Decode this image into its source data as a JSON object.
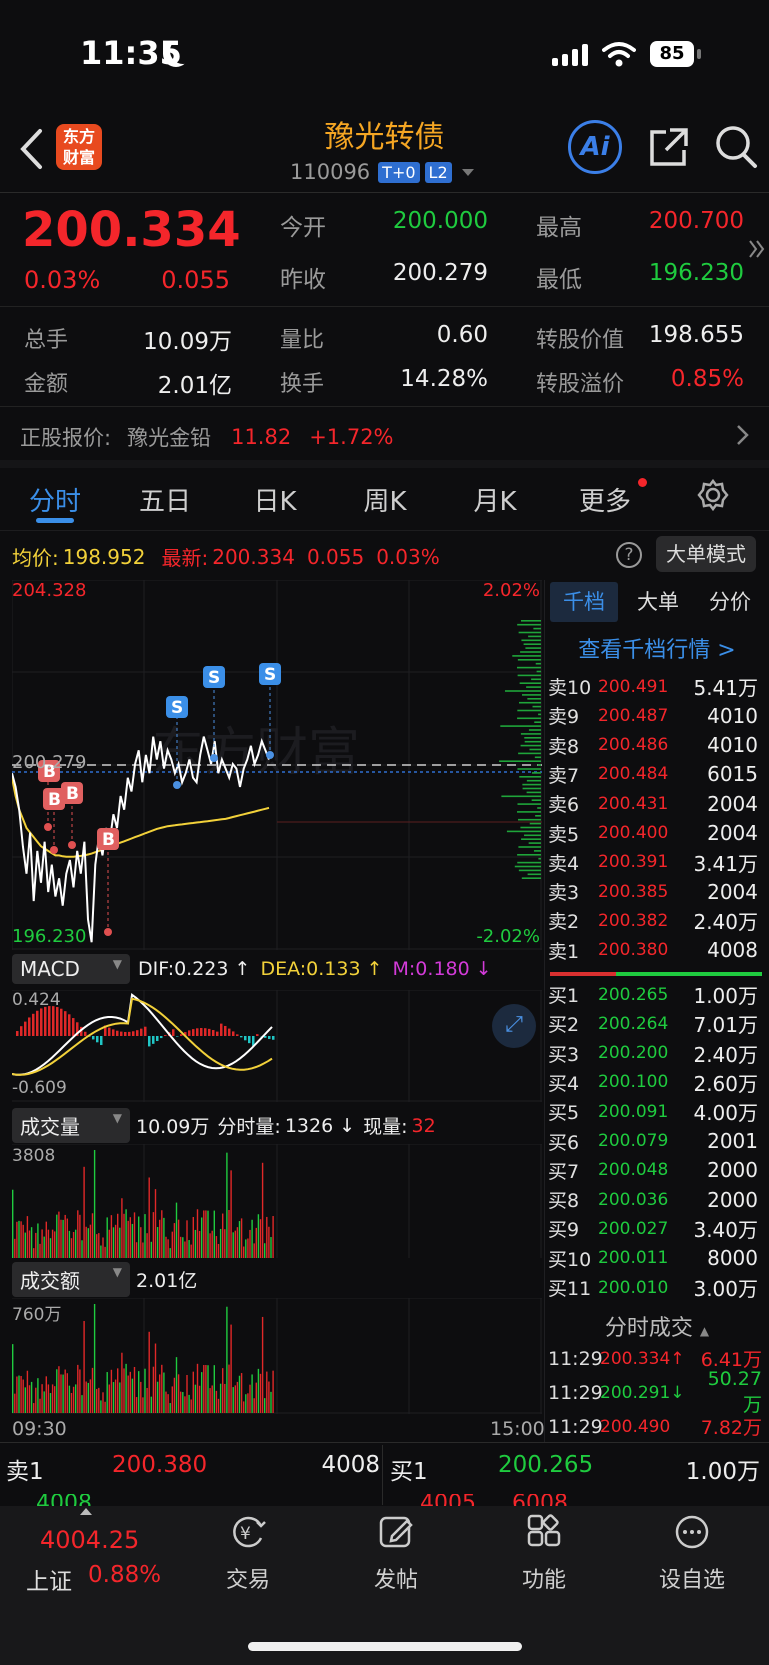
{
  "status": {
    "time": "11:35",
    "battery": "85"
  },
  "header": {
    "logo_line1": "东方",
    "logo_line2": "财富",
    "title": "豫光转债",
    "code": "110096",
    "badge1": "T+0",
    "badge2": "L2",
    "ai": "Ai"
  },
  "quote": {
    "price": "200.334",
    "pct": "0.03%",
    "chg": "0.055",
    "open_label": "今开",
    "open": "200.000",
    "high_label": "最高",
    "high": "200.700",
    "prev_label": "昨收",
    "prev": "200.279",
    "low_label": "最低",
    "low": "196.230",
    "vol_label": "总手",
    "vol": "10.09万",
    "ratio_label": "量比",
    "ratio": "0.60",
    "conv_label": "转股价值",
    "conv": "198.655",
    "amt_label": "金额",
    "amt": "2.01亿",
    "turn_label": "换手",
    "turn": "14.28%",
    "prem_label": "转股溢价",
    "prem": "0.85%"
  },
  "stock": {
    "label": "正股报价:",
    "name": "豫光金铅",
    "price": "11.82",
    "pct": "+1.72%"
  },
  "tabs": [
    "分时",
    "五日",
    "日K",
    "周K",
    "月K",
    "更多"
  ],
  "chart_head": {
    "avg_label": "均价:",
    "avg": "198.952",
    "latest_label": "最新:",
    "latest": "200.334",
    "chg": "0.055",
    "pct": "0.03%",
    "mode": "大单模式"
  },
  "chart_data": {
    "type": "line",
    "ylim": [
      196.23,
      204.328
    ],
    "y_top_label": "204.328",
    "y_bottom_label": "196.230",
    "y_prev_label": "200.279",
    "pct_top": "2.02%",
    "pct_bottom": "-2.02%",
    "x_start": "09:30",
    "x_end": "15:00",
    "price": [
      200.1,
      199.8,
      199.3,
      198.5,
      197.9,
      198.8,
      197.3,
      198.4,
      197.7,
      198.6,
      197.5,
      198.1,
      197.4,
      197.8,
      197.2,
      197.9,
      198.2,
      197.6,
      198.4,
      197.9,
      198.6,
      196.9,
      196.4,
      198.1,
      198.7,
      198.3,
      198.9,
      198.6,
      199.2,
      198.9,
      199.6,
      199.3,
      200.0,
      199.7,
      200.3,
      200.6,
      199.9,
      200.5,
      200.1,
      200.9,
      200.4,
      200.8,
      200.2,
      200.6,
      200.4,
      200.1,
      200.3,
      199.9,
      200.1,
      200.4,
      200.0,
      199.9,
      200.5,
      200.9,
      200.6,
      200.3,
      200.8,
      200.1,
      200.4,
      200.2,
      200.0,
      200.3,
      200.2,
      199.8,
      200.2,
      200.4,
      200.7,
      200.3,
      200.5,
      200.8,
      200.6,
      200.4
    ],
    "avg": [
      200.0,
      199.6,
      199.3,
      199.1,
      198.9,
      198.8,
      198.7,
      198.6,
      198.5,
      198.45,
      198.4,
      198.35,
      198.3,
      198.3,
      198.28,
      198.27,
      198.27,
      198.27,
      198.28,
      198.29,
      198.3,
      198.32,
      198.34,
      198.37,
      198.4,
      198.43,
      198.46,
      198.49,
      198.52,
      198.55,
      198.58,
      198.61,
      198.64,
      198.67,
      198.7,
      198.73,
      198.76,
      198.79,
      198.82,
      198.85,
      198.88,
      198.9,
      198.92,
      198.94,
      198.95,
      198.96,
      198.97,
      198.98,
      198.99,
      199.0,
      199.01,
      199.02,
      199.03,
      199.04,
      199.05,
      199.06,
      199.07,
      199.08,
      199.09,
      199.1,
      199.12,
      199.14,
      199.16,
      199.18,
      199.2,
      199.22,
      199.24,
      199.26,
      199.28,
      199.3,
      199.32,
      199.34
    ]
  },
  "macd": {
    "label": "MACD",
    "dif": "DIF:0.223 ↑",
    "dea": "DEA:0.133 ↑",
    "m": "M:0.180 ↓",
    "top": "0.424",
    "bottom": "-0.609"
  },
  "volume": {
    "label": "成交量",
    "summary": "10.09万",
    "minute_label": "分时量:",
    "minute": "1326 ↓",
    "now_label": "现量:",
    "now": "32",
    "top": "3808"
  },
  "amount": {
    "label": "成交额",
    "summary": "2.01亿",
    "top": "760万"
  },
  "orderbook": {
    "tab1": "千档",
    "tab2": "大单",
    "tab3": "分价",
    "link": "查看千档行情 >",
    "sells": [
      [
        "卖10",
        "200.491",
        "5.41万"
      ],
      [
        "卖9",
        "200.487",
        "4010"
      ],
      [
        "卖8",
        "200.486",
        "4010"
      ],
      [
        "卖7",
        "200.484",
        "6015"
      ],
      [
        "卖6",
        "200.431",
        "2004"
      ],
      [
        "卖5",
        "200.400",
        "2004"
      ],
      [
        "卖4",
        "200.391",
        "3.41万"
      ],
      [
        "卖3",
        "200.385",
        "2004"
      ],
      [
        "卖2",
        "200.382",
        "2.40万"
      ],
      [
        "卖1",
        "200.380",
        "4008"
      ]
    ],
    "buys": [
      [
        "买1",
        "200.265",
        "1.00万"
      ],
      [
        "买2",
        "200.264",
        "7.01万"
      ],
      [
        "买3",
        "200.200",
        "2.40万"
      ],
      [
        "买4",
        "200.100",
        "2.60万"
      ],
      [
        "买5",
        "200.091",
        "4.00万"
      ],
      [
        "买6",
        "200.079",
        "2001"
      ],
      [
        "买7",
        "200.048",
        "2000"
      ],
      [
        "买8",
        "200.036",
        "2000"
      ],
      [
        "买9",
        "200.027",
        "3.40万"
      ],
      [
        "买10",
        "200.011",
        "8000"
      ],
      [
        "买11",
        "200.010",
        "3.00万"
      ]
    ],
    "trades_label": "分时成交",
    "trades": [
      [
        "11:29",
        "200.334↑",
        "6.41万"
      ],
      [
        "11:29",
        "200.291↓",
        "50.27万"
      ],
      [
        "11:29",
        "200.490",
        "7.82万"
      ]
    ]
  },
  "bottom_quote": {
    "sell_label": "卖1",
    "sell_price": "200.380",
    "sell_vol": "4008",
    "buy_label": "买1",
    "buy_price": "200.265",
    "buy_vol": "1.00万",
    "under1": "4008",
    "under2": "4005",
    "under3": "6008"
  },
  "nav": {
    "index_value": "4004.25",
    "index_name": "上证",
    "index_pct": "0.88%",
    "trade": "交易",
    "post": "发帖",
    "func": "功能",
    "watch": "设自选"
  },
  "colors": {
    "up": "#f4262b",
    "down": "#1fcb3f",
    "accent": "#3b8fe8",
    "avg_line": "#f2d13a"
  }
}
